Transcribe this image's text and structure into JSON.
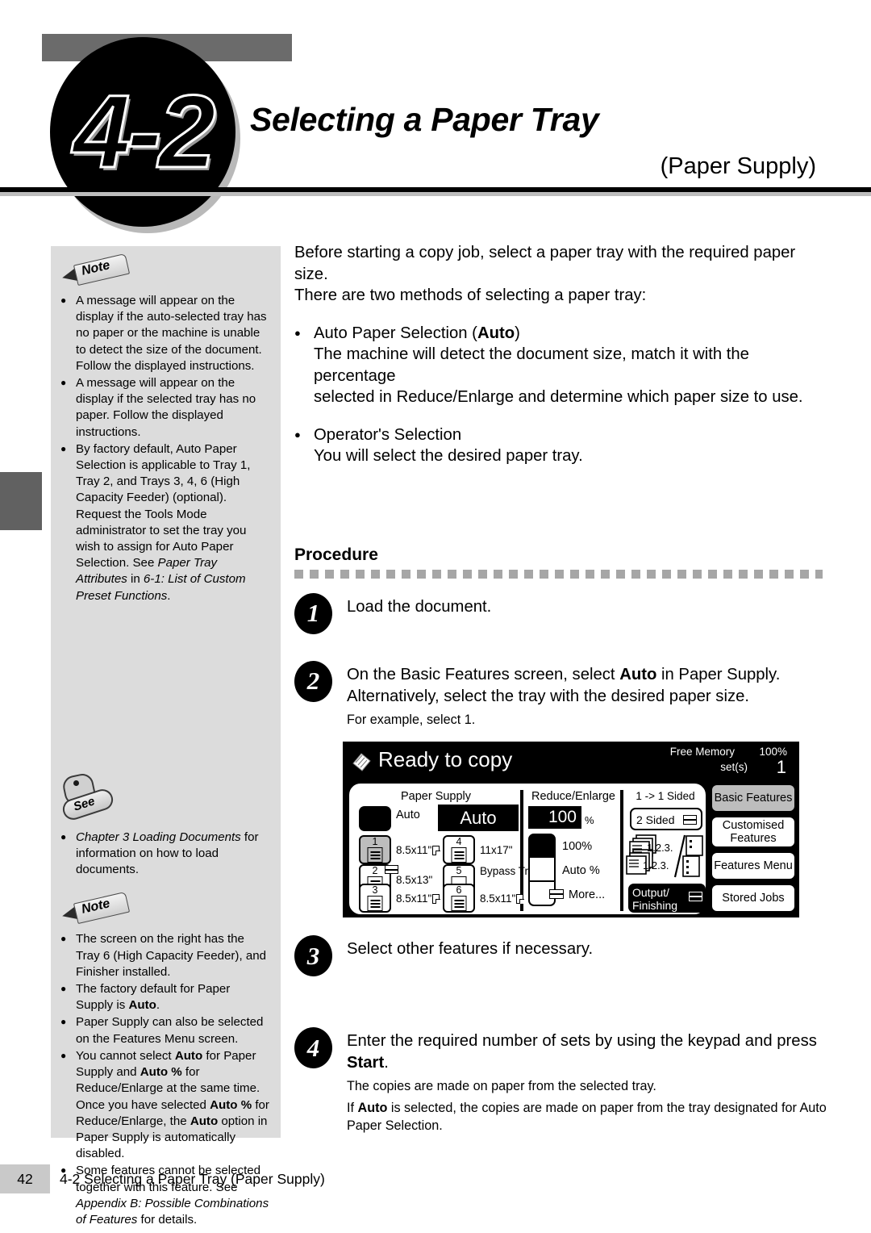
{
  "header": {
    "number": "4-2",
    "title": "Selecting a Paper Tray",
    "subtitle": "(Paper Supply)"
  },
  "sidebar": {
    "note1_tag": "Note",
    "note1_items": [
      "A message will appear on the display if the auto-selected tray has no paper or the machine is unable to detect the size of the document. Follow the displayed instructions.",
      "A message will appear on the display if the selected tray has no paper. Follow the displayed instructions."
    ],
    "note1_item3_a": "By factory default, Auto Paper Selection is applicable to Tray 1, Tray 2, and Trays 3, 4, 6 (High Capacity Feeder) (optional). Request the Tools Mode administrator to set the tray you wish to assign for Auto Paper Selection. See ",
    "note1_item3_i1": "Paper Tray Attributes",
    "note1_item3_b": " in ",
    "note1_item3_i2": "6-1: List of Custom Preset Functions",
    "note1_item3_c": ".",
    "see_tag": "See",
    "see_item_i": "Chapter 3 Loading Documents",
    "see_item_rest": " for information on how to load documents.",
    "note2_tag": "Note",
    "note2_item1": "The screen on the right has the Tray 6 (High Capacity Feeder), and Finisher installed.",
    "note2_item2_a": "The factory default for Paper Supply is ",
    "note2_item2_b": "Auto",
    "note2_item2_c": ".",
    "note2_item3": "Paper Supply can also be selected on the Features Menu screen.",
    "note2_item4_a": "You cannot select ",
    "note2_item4_b1": "Auto",
    "note2_item4_c": " for Paper Supply and ",
    "note2_item4_b2": "Auto %",
    "note2_item4_d": " for Reduce/Enlarge at the same time. Once you have selected ",
    "note2_item4_b3": "Auto %",
    "note2_item4_e": " for Reduce/Enlarge, the ",
    "note2_item4_b4": "Auto",
    "note2_item4_f": " option in Paper Supply is automatically disabled.",
    "note2_item5_a": "Some features cannot be selected together with this feature. See ",
    "note2_item5_i": "Appendix B: Possible Combinations of Features",
    "note2_item5_b": " for details."
  },
  "main": {
    "intro_line1": "Before starting a copy job, select a paper tray with the required paper size.",
    "intro_line2": "There are two methods of selecting a paper tray:",
    "bullet1_a": "Auto Paper Selection (",
    "bullet1_b": "Auto",
    "bullet1_c": ")",
    "bullet1_sub1": "The machine will detect the document size, match it with the percentage",
    "bullet1_sub2": "selected in Reduce/Enlarge and determine which paper size to use.",
    "bullet2": "Operator's Selection",
    "bullet2_sub": "You will select the desired paper tray.",
    "procedure_title": "Procedure",
    "steps": [
      {
        "num": "1",
        "text": "Load the document."
      },
      {
        "num": "2",
        "text_a": "On the Basic Features screen, select ",
        "text_b": "Auto",
        "text_c": " in Paper Supply.",
        "text_line2": "Alternatively, select the tray with the desired paper size.",
        "note": "For example, select 1."
      },
      {
        "num": "3",
        "text": "Select other features if necessary."
      },
      {
        "num": "4",
        "text_a": "Enter the required number of sets by using the keypad and press ",
        "text_b": "Start",
        "text_c": ".",
        "note1": "The copies are made on paper from the selected tray.",
        "note2_a": "If ",
        "note2_b": "Auto",
        "note2_c": " is selected, the copies are made on paper from the tray designated for Auto Paper Selection."
      }
    ]
  },
  "screen": {
    "status": "Ready to copy",
    "free_memory_label": "Free Memory",
    "free_memory_value": "100%",
    "sets_label": "set(s)",
    "sets_value": "1",
    "paper_supply": {
      "title": "Paper Supply",
      "auto_label": "Auto",
      "auto_selected_value": "Auto",
      "trays": [
        {
          "num": "1",
          "size": "8.5x11\"",
          "selected": true,
          "paper_icon": true,
          "badge": false,
          "bypass": false
        },
        {
          "num": "2",
          "size": "8.5x13\"",
          "selected": false,
          "paper_icon": false,
          "badge": true,
          "bypass": false
        },
        {
          "num": "3",
          "size": "8.5x11\"",
          "selected": false,
          "paper_icon": true,
          "badge": false,
          "bypass": false
        },
        {
          "num": "4",
          "size": "11x17\"",
          "selected": false,
          "paper_icon": false,
          "badge": false,
          "bypass": false
        },
        {
          "num": "5",
          "size": "Bypass Tray",
          "selected": false,
          "paper_icon": false,
          "badge": false,
          "bypass": true
        },
        {
          "num": "6",
          "size": "8.5x11\"",
          "selected": false,
          "paper_icon": true,
          "badge": false,
          "bypass": false
        }
      ]
    },
    "reduce_enlarge": {
      "title": "Reduce/Enlarge",
      "value": "100",
      "percent_sign": "%",
      "option_100": "100%",
      "option_auto": "Auto %",
      "option_more": "More..."
    },
    "sided": {
      "title": "1 -> 1 Sided",
      "two_sided_label": "2 Sided",
      "output_finishing_line1": "Output/",
      "output_finishing_line2": "Finishing",
      "collate_marks": "1.2.3."
    },
    "tabs": [
      {
        "label": "Basic Features",
        "active": true
      },
      {
        "label": "Customised Features",
        "active": false
      },
      {
        "label": "Features Menu",
        "active": false
      },
      {
        "label": "Stored Jobs",
        "active": false
      }
    ]
  },
  "footer": {
    "page_number": "42",
    "text": "4-2  Selecting a Paper Tray (Paper Supply)"
  }
}
